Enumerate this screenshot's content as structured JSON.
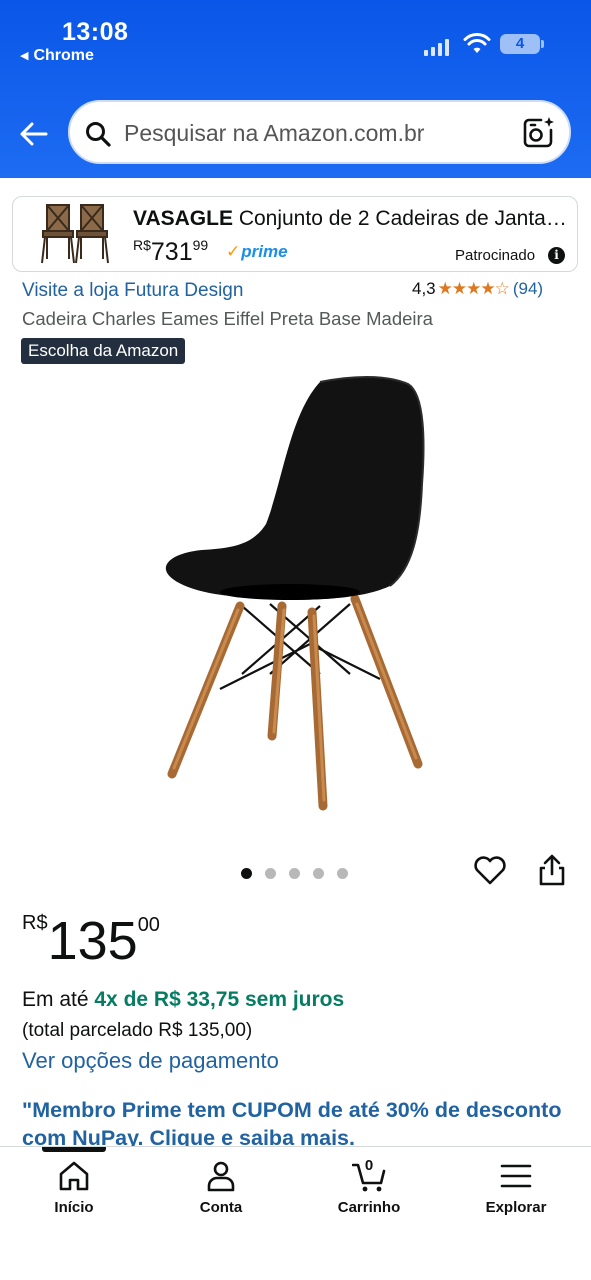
{
  "status_bar": {
    "time": "13:08",
    "back_app": "Chrome",
    "battery": "4"
  },
  "header": {
    "search_placeholder": "Pesquisar na Amazon.com.br",
    "icons": [
      "back-arrow-icon",
      "search-icon",
      "camera-search-icon"
    ]
  },
  "sponsored_ad": {
    "brand": "VASAGLE",
    "title": "Conjunto de 2 Cadeiras de Janta…",
    "currency": "R$",
    "price_whole": "731",
    "price_cents": "99",
    "prime_label": "prime",
    "sponsored_label": "Patrocinado",
    "info_icon": "i"
  },
  "product": {
    "store_link": "Visite a loja Futura Design",
    "rating_value": "4,3",
    "rating_stars": 4.3,
    "stars_display": "★★★★☆",
    "review_count": "(94)",
    "title": "Cadeira Charles Eames Eiffel Preta Base Madeira",
    "badge": "Escolha da Amazon",
    "image_count": 5,
    "active_image": 0
  },
  "pricing": {
    "currency": "R$",
    "whole": "135",
    "cents": "00",
    "installments_prefix": "Em até",
    "installments_highlight": "4x de R$ 33,75 sem juros",
    "total_text": "(total parcelado R$ 135,00)",
    "payment_link": "Ver opções de pagamento",
    "promo_text": "\"Membro Prime tem CUPOM de até 30% de desconto com NuPay. Clique e saiba mais."
  },
  "bottom_nav": {
    "items": [
      {
        "label": "Início",
        "icon": "home-icon"
      },
      {
        "label": "Conta",
        "icon": "account-icon"
      },
      {
        "label": "Carrinho",
        "icon": "cart-icon",
        "count": "0"
      },
      {
        "label": "Explorar",
        "icon": "menu-icon"
      }
    ]
  },
  "colors": {
    "header_blue": "#1d6cf2",
    "link_blue": "#2162a1",
    "installment_green": "#067d62",
    "star_orange": "#de7921",
    "badge_dark": "#232f3e"
  }
}
